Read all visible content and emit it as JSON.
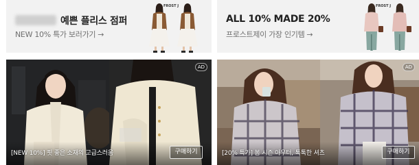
{
  "banners": [
    {
      "title": "예쁜 플리스 점퍼",
      "subtitle": "NEW 10% 특가 보러가기",
      "arrow": "→",
      "brand_tag": "FROST J",
      "title_prefix_blurred": true
    },
    {
      "title": "ALL 10% MADE 20%",
      "subtitle": "프로스트제이 가장 인기템",
      "arrow": "→",
      "brand_tag": "FROST J"
    }
  ],
  "cards": [
    {
      "caption": "[NEW 10%] 핏 좋은 소재의 고급스러움",
      "button": "구매하기",
      "badge": "AD"
    },
    {
      "caption": "[20% 특가] 봄 시즌 아우터, 톡톡한 셔츠",
      "button": "구매하기",
      "badge": "AD"
    }
  ],
  "colors": {
    "banner_bg": "#f2f2f2",
    "title_text": "#222222",
    "subtitle_text": "#6f6f6f",
    "button_border": "#ffffff"
  }
}
